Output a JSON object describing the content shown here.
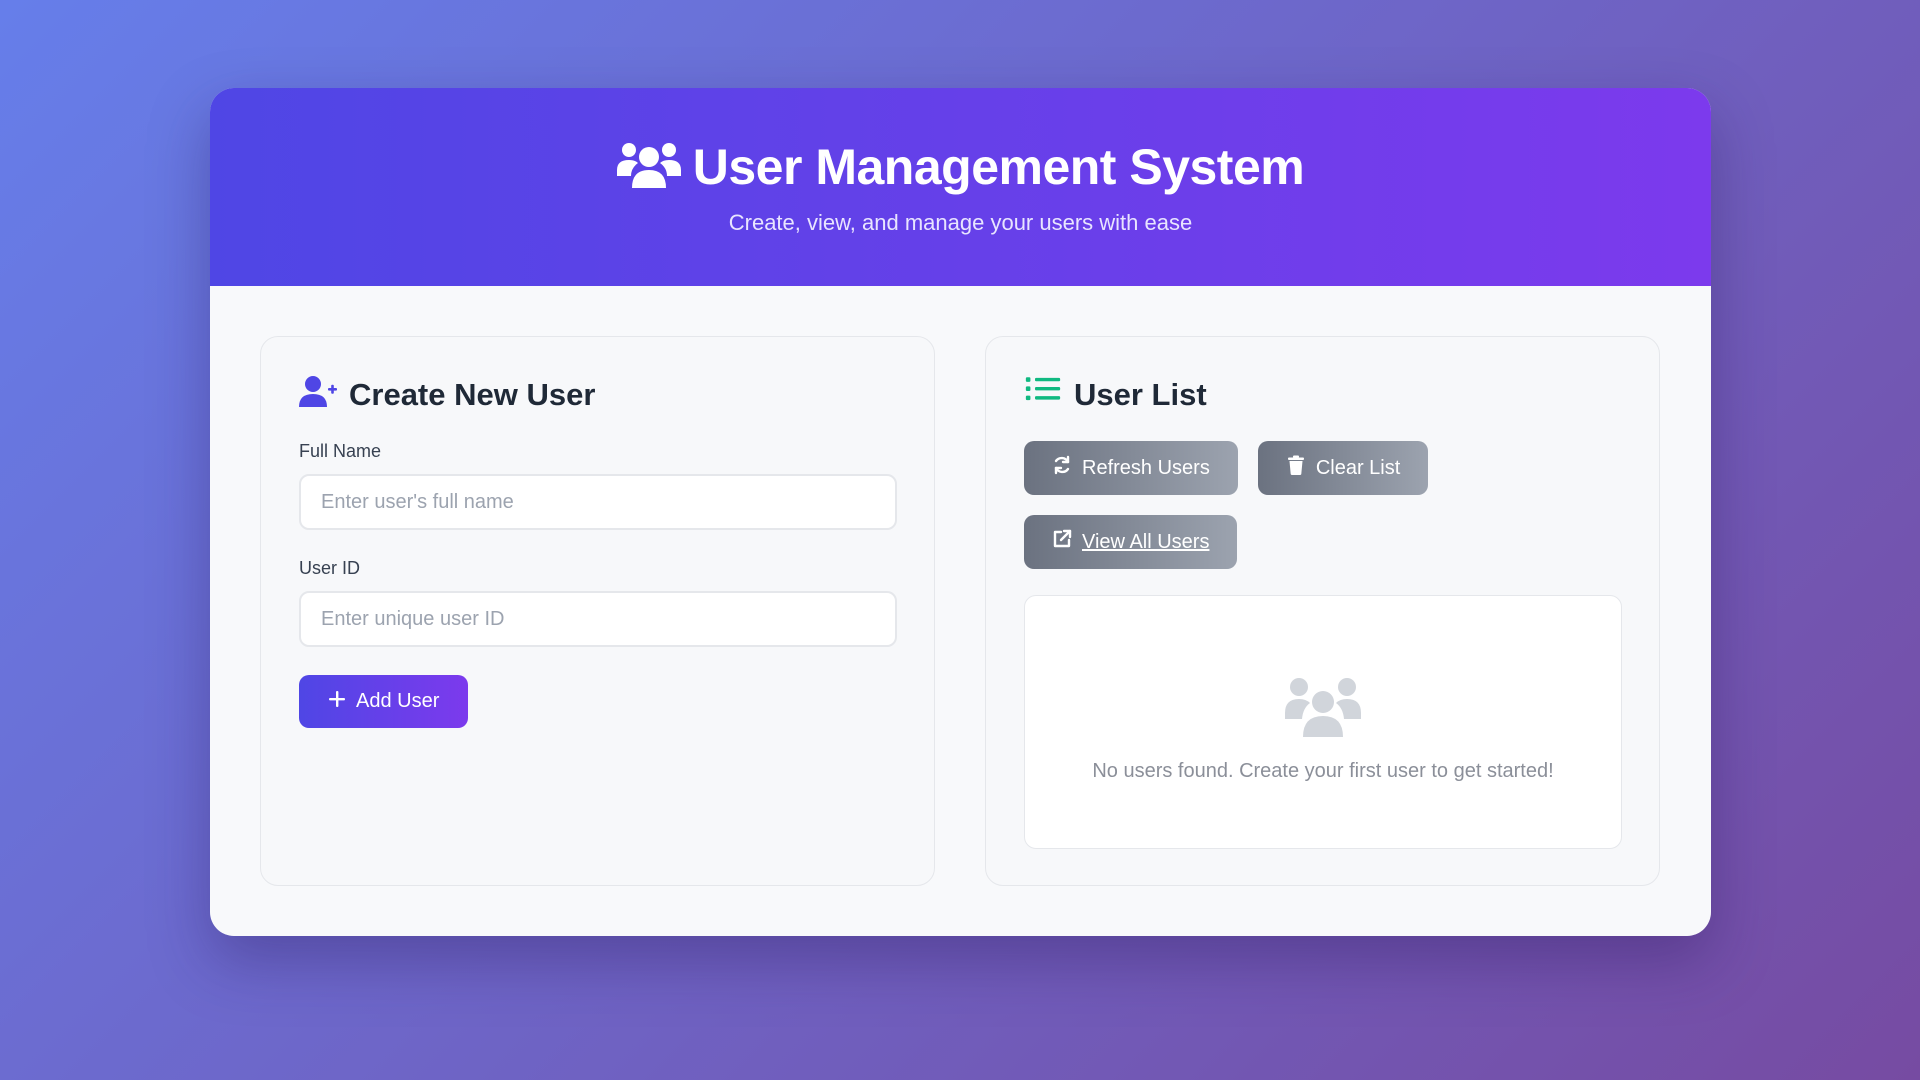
{
  "header": {
    "icon": "users-icon",
    "title": "User Management System",
    "subtitle": "Create, view, and manage your users with ease"
  },
  "create_user": {
    "icon": "user-plus-icon",
    "title": "Create New User",
    "full_name": {
      "label": "Full Name",
      "value": "",
      "placeholder": "Enter user's full name"
    },
    "user_id": {
      "label": "User ID",
      "value": "",
      "placeholder": "Enter unique user ID"
    },
    "add_button": {
      "icon": "plus-icon",
      "label": "Add User"
    }
  },
  "user_list": {
    "icon": "list-icon",
    "title": "User List",
    "refresh_button": {
      "icon": "refresh-icon",
      "label": "Refresh Users"
    },
    "clear_button": {
      "icon": "trash-icon",
      "label": "Clear List"
    },
    "view_all_button": {
      "icon": "external-link-icon",
      "label": "View All Users"
    },
    "empty_state": {
      "icon": "users-icon",
      "message": "No users found. Create your first user to get started!"
    }
  },
  "colors": {
    "background_start": "#667eea",
    "background_end": "#764ba2",
    "accent_start": "#4f46e5",
    "accent_end": "#7c3aed",
    "list_icon": "#10b981",
    "secondary_button": "#6b7280"
  }
}
